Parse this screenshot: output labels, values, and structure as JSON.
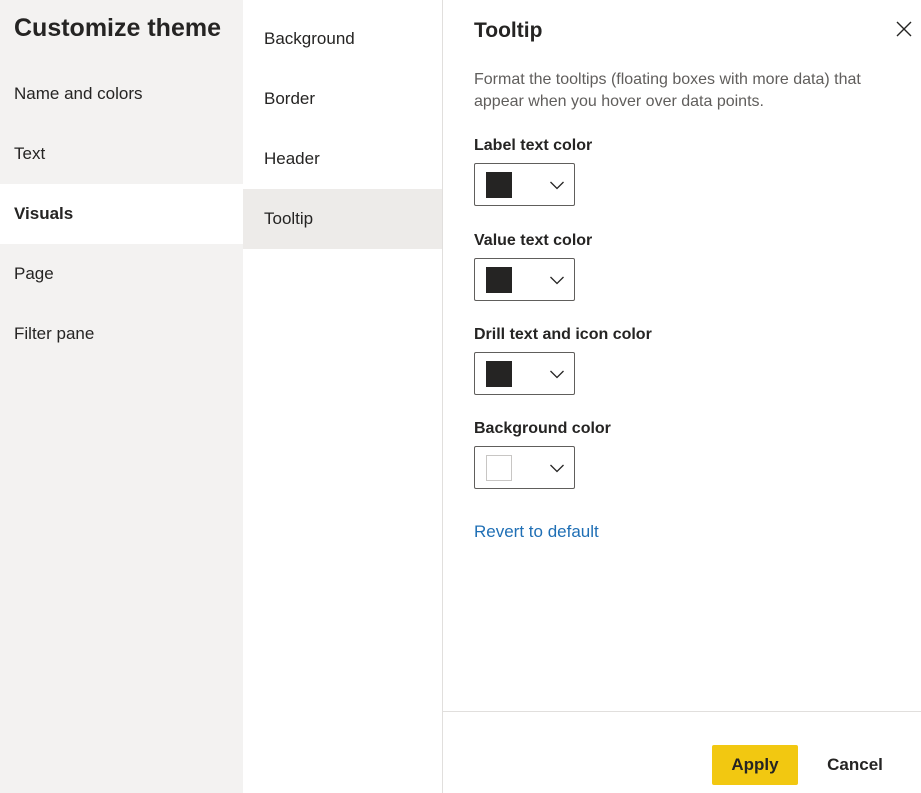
{
  "dialog": {
    "title": "Customize theme"
  },
  "left_nav": {
    "items": [
      {
        "label": "Name and colors"
      },
      {
        "label": "Text"
      },
      {
        "label": "Visuals",
        "selected": true
      },
      {
        "label": "Page"
      },
      {
        "label": "Filter pane"
      }
    ]
  },
  "sub_nav": {
    "items": [
      {
        "label": "Background"
      },
      {
        "label": "Border"
      },
      {
        "label": "Header"
      },
      {
        "label": "Tooltip",
        "selected": true
      }
    ]
  },
  "section": {
    "title": "Tooltip",
    "description": "Format the tooltips (floating boxes with more data) that appear when you hover over data points.",
    "fields": [
      {
        "label": "Label text color",
        "color": "#252423",
        "icon": "chevron-down-icon"
      },
      {
        "label": "Value text color",
        "color": "#252423",
        "icon": "chevron-down-icon"
      },
      {
        "label": "Drill text and icon color",
        "color": "#252423",
        "icon": "chevron-down-icon"
      },
      {
        "label": "Background color",
        "color": "#ffffff",
        "icon": "chevron-down-icon"
      }
    ],
    "revert_label": "Revert to default"
  },
  "footer": {
    "apply_label": "Apply",
    "cancel_label": "Cancel"
  },
  "colors": {
    "accent": "#f2c811",
    "link": "#1f6fb5",
    "left_panel_bg": "#f3f2f1",
    "selected_sub_bg": "#edebe9"
  },
  "icons": {
    "close": "close-icon"
  }
}
